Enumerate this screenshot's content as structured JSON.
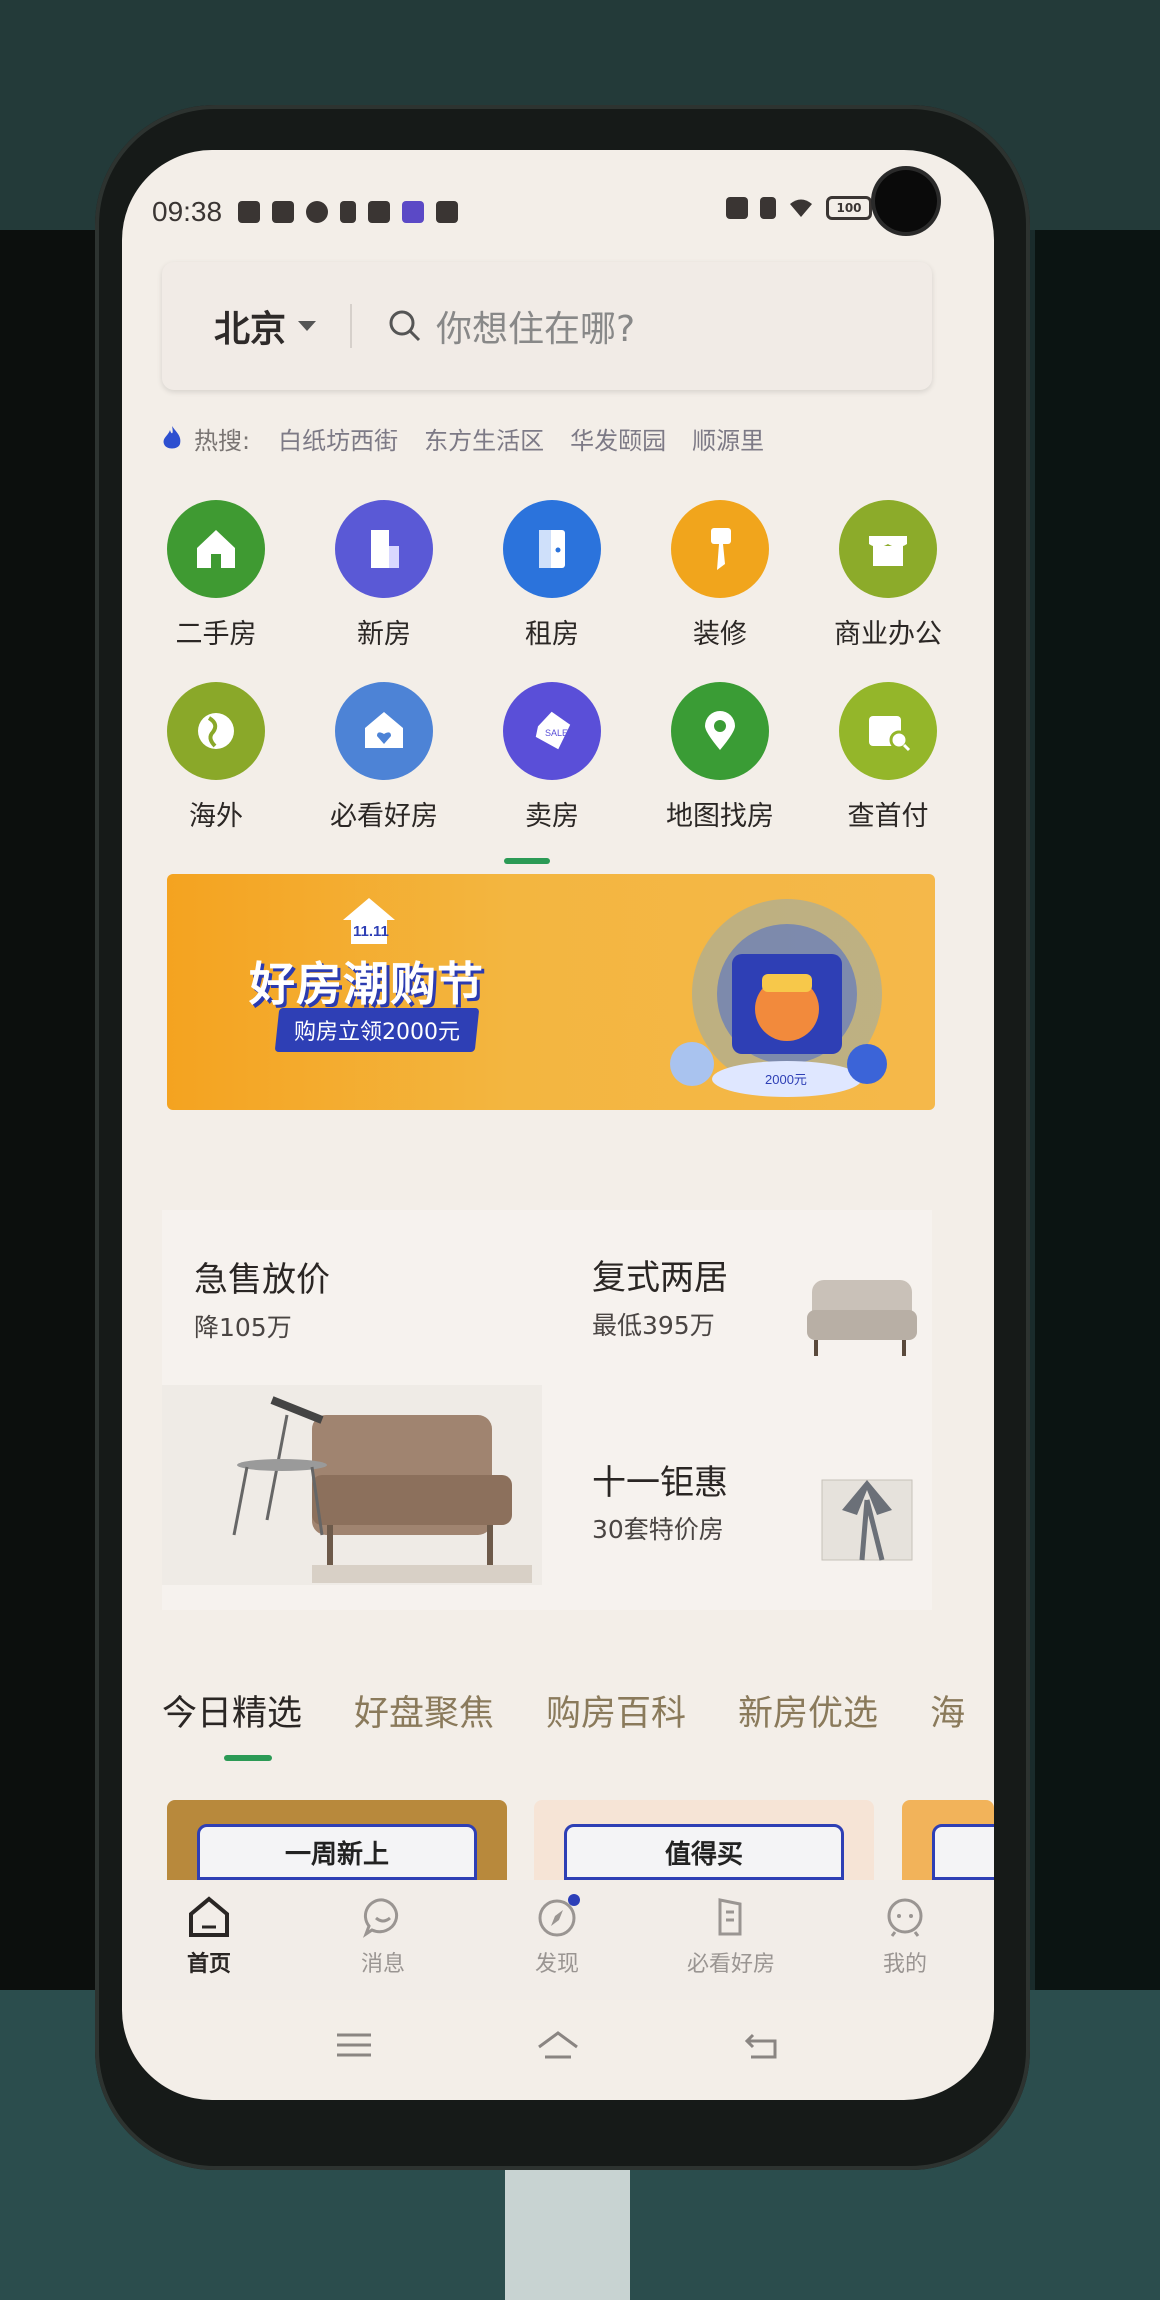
{
  "status_bar": {
    "time": "09:38",
    "battery": "100"
  },
  "search": {
    "city": "北京",
    "placeholder": "你想住在哪?"
  },
  "hot_search": {
    "label": "热搜:",
    "items": [
      "白纸坊西街",
      "东方生活区",
      "华发颐园",
      "顺源里"
    ]
  },
  "categories": [
    {
      "label": "二手房",
      "icon": "home-icon",
      "color": "#3f9a32"
    },
    {
      "label": "新房",
      "icon": "building-icon",
      "color": "#5a59d6"
    },
    {
      "label": "租房",
      "icon": "door-icon",
      "color": "#2b73dc"
    },
    {
      "label": "装修",
      "icon": "paint-brush-icon",
      "color": "#f1a51c"
    },
    {
      "label": "商业办公",
      "icon": "shop-icon",
      "color": "#8cab2a"
    },
    {
      "label": "海外",
      "icon": "globe-icon",
      "color": "#8aa829"
    },
    {
      "label": "必看好房",
      "icon": "house-heart-icon",
      "color": "#4d83d6"
    },
    {
      "label": "卖房",
      "icon": "sale-tag-icon",
      "color": "#5a4fd8"
    },
    {
      "label": "地图找房",
      "icon": "map-pin-icon",
      "color": "#3a9c35"
    },
    {
      "label": "查首付",
      "icon": "wallet-search-icon",
      "color": "#94b62a"
    }
  ],
  "banner": {
    "badge": "11.11",
    "title": "好房潮购节",
    "subtitle": "购房立领2000元",
    "coin_text": "2000元"
  },
  "promos": [
    {
      "title": "急售放价",
      "subtitle": "降105万"
    },
    {
      "title": "复式两居",
      "subtitle": "最低395万"
    },
    {
      "title": "十一钜惠",
      "subtitle": "30套特价房"
    }
  ],
  "feed_tabs": [
    "今日精选",
    "好盘聚焦",
    "购房百科",
    "新房优选",
    "海"
  ],
  "feed_cards": [
    "一周新上",
    "值得买"
  ],
  "bottom_nav": [
    "首页",
    "消息",
    "发现",
    "必看好房",
    "我的"
  ],
  "accent_color": "#2b9a55"
}
